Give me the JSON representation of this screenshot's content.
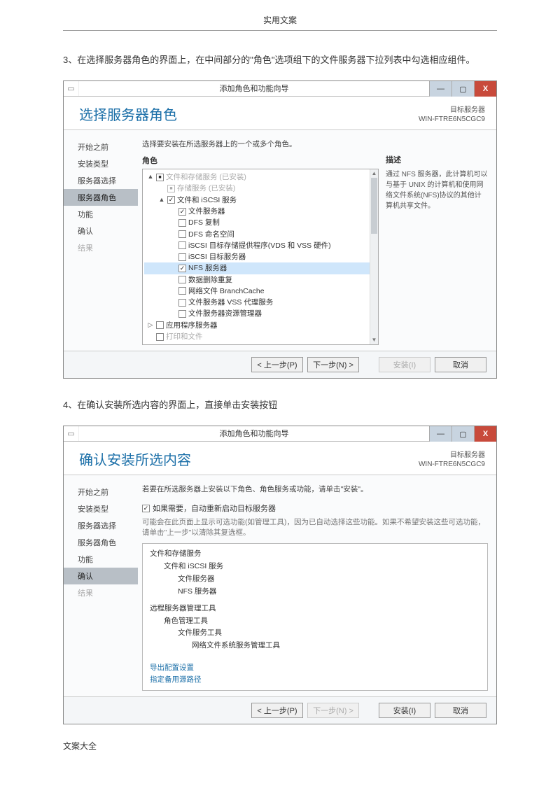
{
  "doc": {
    "header": "实用文案",
    "para3": "3、在选择服务器角色的界面上，在中间部分的\"角色\"选项组下的文件服务器下拉列表中勾选相应组件。",
    "para4": "4、在确认安装所选内容的界面上，直接单击安装按钮",
    "footer": "文案大全"
  },
  "shot1": {
    "window_title": "添加角色和功能向导",
    "page_title": "选择服务器角色",
    "target_label": "目标服务器",
    "target_value": "WIN-FTRE6N5CGC9",
    "nav": [
      "开始之前",
      "安装类型",
      "服务器选择",
      "服务器角色",
      "功能",
      "确认",
      "结果"
    ],
    "nav_active_index": 3,
    "instruction": "选择要安装在所选服务器上的一个或多个角色。",
    "roles_header": "角色",
    "desc_header": "描述",
    "desc_text": "通过 NFS 服务器，此计算机可以与基于 UNIX 的计算机和使用网络文件系统(NFS)协议的其他计算机共享文件。",
    "roles": [
      {
        "level": 1,
        "tw": "▲",
        "cb": "filled",
        "label": "文件和存储服务 (已安装)",
        "dim": true
      },
      {
        "level": 2,
        "tw": "",
        "cb": "faded",
        "label": "存储服务 (已安装)",
        "dim": true
      },
      {
        "level": 2,
        "tw": "▲",
        "cb": "checked",
        "label": "文件和 iSCSI 服务"
      },
      {
        "level": 3,
        "tw": "",
        "cb": "checked",
        "label": "文件服务器"
      },
      {
        "level": 3,
        "tw": "",
        "cb": "none",
        "label": "DFS 复制"
      },
      {
        "level": 3,
        "tw": "",
        "cb": "none",
        "label": "DFS 命名空间"
      },
      {
        "level": 3,
        "tw": "",
        "cb": "none",
        "label": "iSCSI 目标存储提供程序(VDS 和 VSS 硬件)"
      },
      {
        "level": 3,
        "tw": "",
        "cb": "none",
        "label": "iSCSI 目标服务器"
      },
      {
        "level": 3,
        "tw": "",
        "cb": "checked",
        "label": "NFS 服务器",
        "hilite": true
      },
      {
        "level": 3,
        "tw": "",
        "cb": "none",
        "label": "数据删除重复"
      },
      {
        "level": 3,
        "tw": "",
        "cb": "none",
        "label": "网络文件 BranchCache"
      },
      {
        "level": 3,
        "tw": "",
        "cb": "none",
        "label": "文件服务器 VSS 代理服务"
      },
      {
        "level": 3,
        "tw": "",
        "cb": "none",
        "label": "文件服务器资源管理器"
      },
      {
        "level": 1,
        "tw": "▷",
        "cb": "none",
        "label": "应用程序服务器"
      },
      {
        "level": 1,
        "tw": "",
        "cb": "none",
        "label": "打印和文件",
        "dim": true
      }
    ],
    "buttons": {
      "prev": "< 上一步(P)",
      "next": "下一步(N) >",
      "install": "安装(I)",
      "cancel": "取消"
    }
  },
  "shot2": {
    "window_title": "添加角色和功能向导",
    "page_title": "确认安装所选内容",
    "target_label": "目标服务器",
    "target_value": "WIN-FTRE6N5CGC9",
    "nav": [
      "开始之前",
      "安装类型",
      "服务器选择",
      "服务器角色",
      "功能",
      "确认",
      "结果"
    ],
    "nav_active_index": 5,
    "instruction": "若要在所选服务器上安装以下角色、角色服务或功能，请单击\"安装\"。",
    "auto_restart_label": "如果需要，自动重新启动目标服务器",
    "note": "可能会在此页面上显示可选功能(如管理工具)，因为已自动选择这些功能。如果不希望安装这些可选功能，请单击\"上一步\"以清除其复选框。",
    "confirm_items": [
      {
        "level": 1,
        "text": "文件和存储服务"
      },
      {
        "level": 2,
        "text": "文件和 iSCSI 服务"
      },
      {
        "level": 3,
        "text": "文件服务器"
      },
      {
        "level": 3,
        "text": "NFS 服务器"
      },
      {
        "level": 1,
        "text": "远程服务器管理工具",
        "top_gap": true
      },
      {
        "level": 2,
        "text": "角色管理工具"
      },
      {
        "level": 3,
        "text": "文件服务工具"
      },
      {
        "level": 4,
        "text": "网络文件系统服务管理工具"
      }
    ],
    "link_export": "导出配置设置",
    "link_altpath": "指定备用源路径",
    "buttons": {
      "prev": "< 上一步(P)",
      "next": "下一步(N) >",
      "install": "安装(I)",
      "cancel": "取消"
    }
  }
}
